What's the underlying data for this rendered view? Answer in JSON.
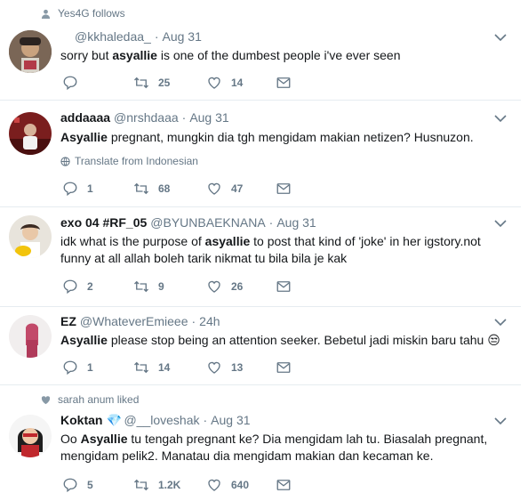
{
  "tweets": [
    {
      "context": "Yes4G follows",
      "context_icon": "person-icon",
      "name": "",
      "handle": "@kkhaledaa_",
      "time": "Aug 31",
      "text_parts": [
        "sorry but ",
        "asyallie",
        " is one of the dumbest people i've ever seen"
      ],
      "translate": "",
      "replies": "",
      "retweets": "25",
      "likes": "14"
    },
    {
      "context": "",
      "name": "addaaaa",
      "handle": "@nrshdaaa",
      "time": "Aug 31",
      "text_parts": [
        "",
        "Asyallie",
        " pregnant, mungkin dia tgh mengidam makian netizen? Husnuzon."
      ],
      "translate": "Translate from Indonesian",
      "replies": "1",
      "retweets": "68",
      "likes": "47"
    },
    {
      "context": "",
      "name": "exo 04 #RF_05",
      "handle": "@BYUNBAEKNANA",
      "time": "Aug 31",
      "text_parts": [
        "idk what is the purpose of ",
        "asyallie",
        " to post that kind of 'joke' in her igstory.not funny at all allah boleh tarik nikmat tu bila bila je kak"
      ],
      "translate": "",
      "replies": "2",
      "retweets": "9",
      "likes": "26"
    },
    {
      "context": "",
      "name": "EZ",
      "handle": "@WhateverEmieee",
      "time": "24h",
      "text_parts": [
        "",
        "Asyallie",
        " please stop being an attention seeker. Bebetul jadi miskin baru tahu"
      ],
      "emoji": "😒",
      "translate": "",
      "replies": "1",
      "retweets": "14",
      "likes": "13"
    },
    {
      "context": "sarah anum liked",
      "context_icon": "heart-icon",
      "name": "Koktan",
      "name_badge": "💎",
      "handle": "@__loveshak",
      "time": "Aug 31",
      "text_parts": [
        "Oo ",
        "Asyallie",
        " tu tengah pregnant ke? Dia mengidam lah tu. Biasalah pregnant, mengidam pelik2. Manatau dia mengidam makian dan kecaman ke."
      ],
      "translate": "",
      "replies": "5",
      "retweets": "1.2K",
      "likes": "640"
    }
  ],
  "colors": {
    "text": "#14171a",
    "muted": "#657786",
    "divider": "#e6ecf0"
  }
}
